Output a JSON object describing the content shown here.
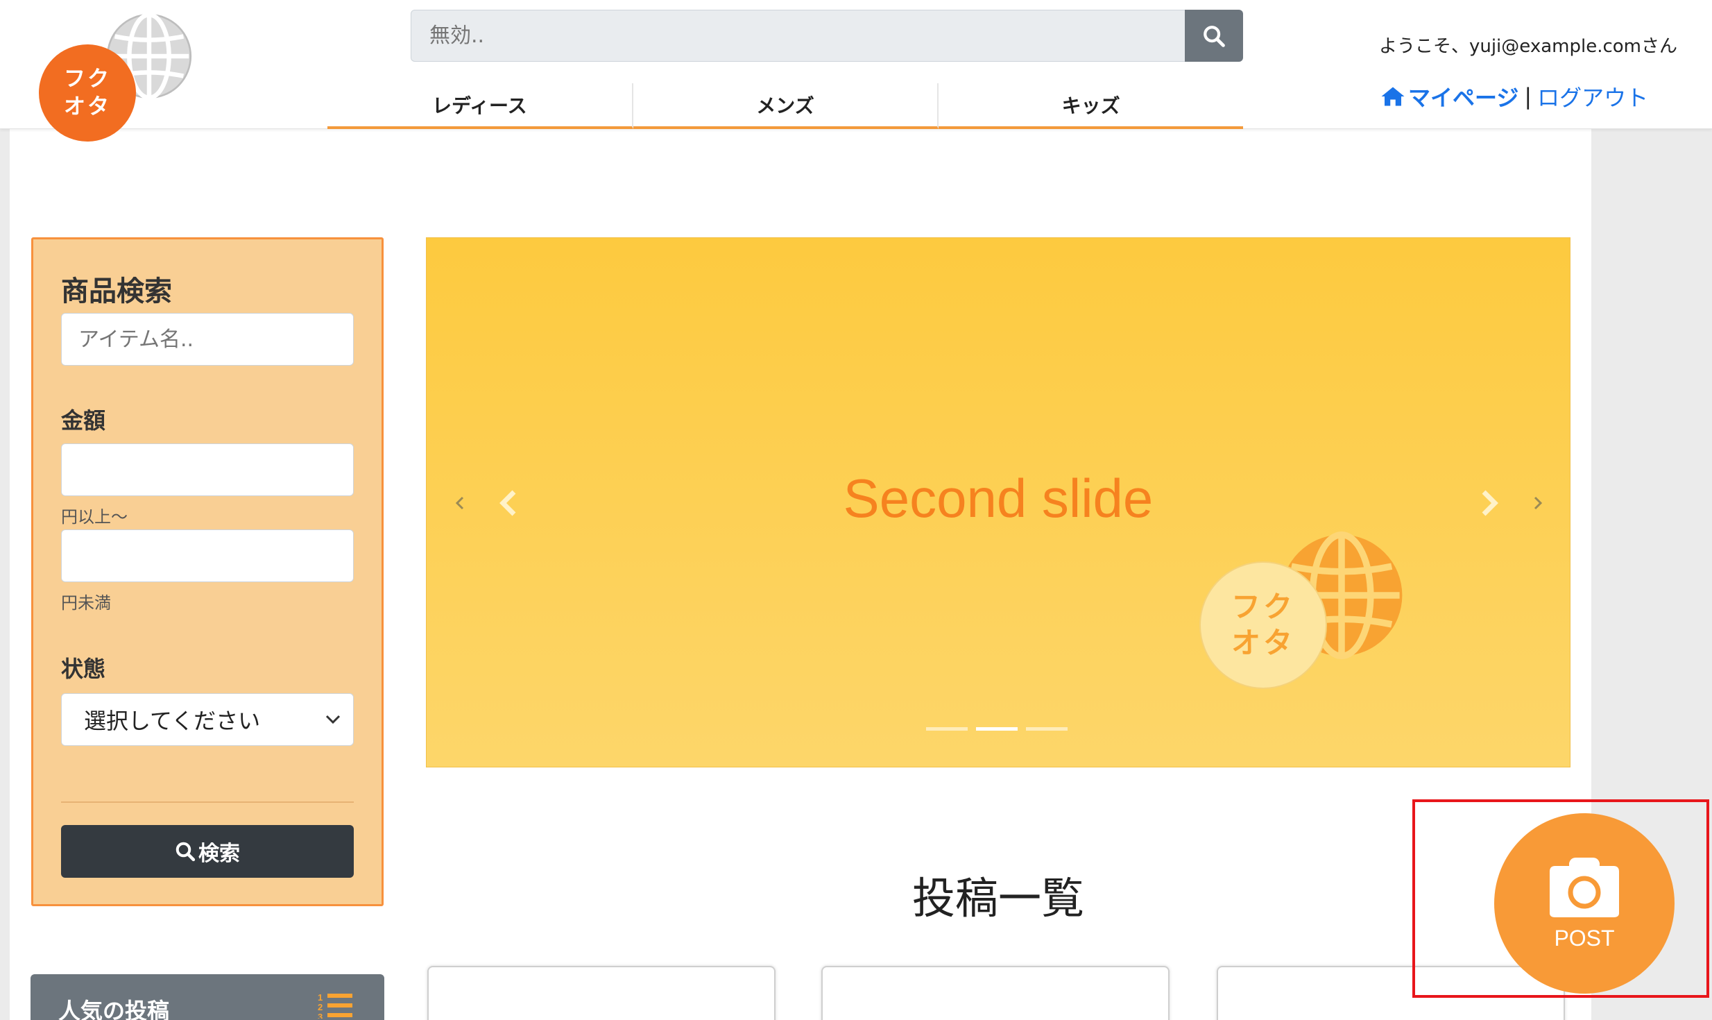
{
  "header": {
    "logo_text": "フク\nオタ",
    "search": {
      "placeholder": "無効.."
    },
    "tabs": [
      "レディース",
      "メンズ",
      "キッズ"
    ],
    "welcome": "ようこそ、yuji@example.comさん",
    "mypage_label": "マイページ",
    "separator": "|",
    "logout_label": "ログアウト"
  },
  "sidebar": {
    "title": "商品検索",
    "item_name_placeholder": "アイテム名..",
    "price_label": "金額",
    "price_min_note": "円以上〜",
    "price_max_note": "円未満",
    "condition_label": "状態",
    "condition_selected": "選択してください",
    "search_button": "検索",
    "popular_title": "人気の投稿"
  },
  "carousel": {
    "caption": "Second slide",
    "logo_text": "フク\nオタ",
    "slide_count": 3,
    "active_index": 1
  },
  "main": {
    "posts_heading": "投稿一覧"
  },
  "fab": {
    "label": "POST",
    "icon": "camera-icon",
    "highlight_color": "#e8161b"
  },
  "colors": {
    "brand_orange": "#f26d21",
    "accent_orange": "#f89a37",
    "link_blue": "#1a73e8",
    "panel_bg": "#f9cf94"
  }
}
